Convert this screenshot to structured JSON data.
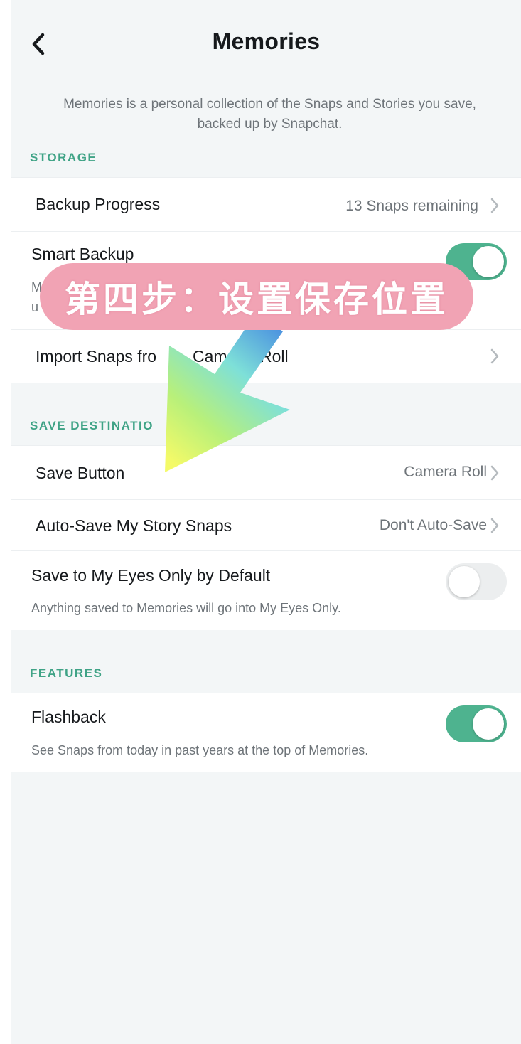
{
  "header": {
    "title": "Memories",
    "intro": "Memories is a personal collection of the Snaps and Stories you save, backed up by Snapchat."
  },
  "storage": {
    "label": "STORAGE",
    "backup_progress": {
      "title": "Backup Progress",
      "value": "13 Snaps remaining"
    },
    "smart_backup": {
      "title": "Smart Backup",
      "subtitle_partial": "M",
      "subtitle_partial_2": "u",
      "enabled": true
    },
    "import": {
      "title_left": "Import Snaps fro",
      "title_right": "Cam",
      "title_end": "Roll"
    }
  },
  "save_destination": {
    "label": "SAVE DESTINATIO",
    "save_button": {
      "title": "Save Button",
      "value": "Camera Roll"
    },
    "auto_save": {
      "title": "Auto-Save My Story Snaps",
      "value": "Don't Auto-Save"
    },
    "eyes_only": {
      "title": "Save to My Eyes Only by Default",
      "subtitle": "Anything saved to Memories will go into My Eyes Only.",
      "enabled": false
    }
  },
  "features": {
    "label": "FEATURES",
    "flashback": {
      "title": "Flashback",
      "subtitle": "See Snaps from today in past years at the top of Memories.",
      "enabled": true
    }
  },
  "overlay": {
    "banner_text": "第四步：设置保存位置"
  },
  "colors": {
    "accent_green": "#3fa386",
    "toggle_on": "#4eb38f",
    "banner_pink": "#f1a3b4"
  }
}
